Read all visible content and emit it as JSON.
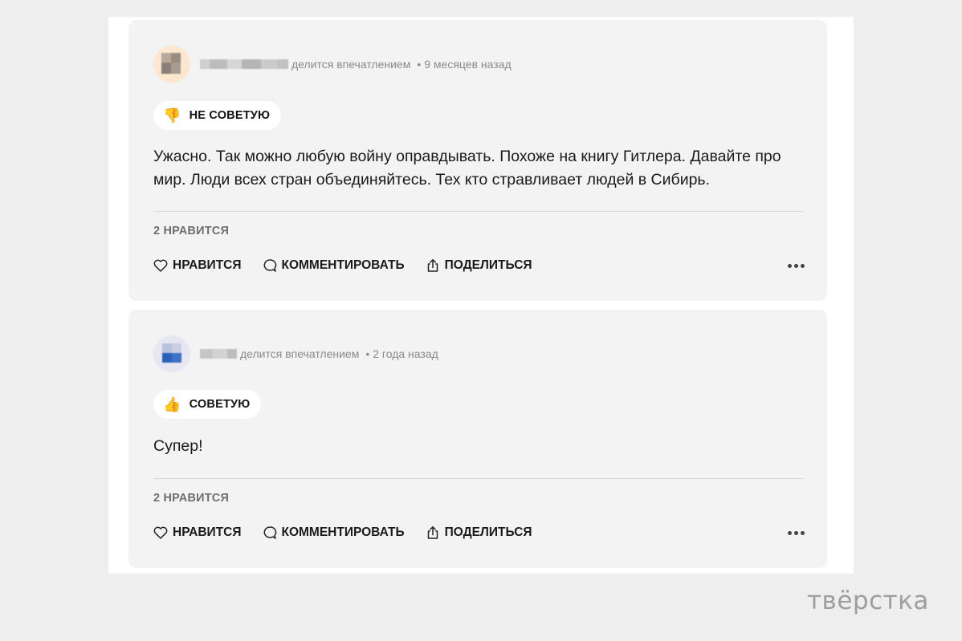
{
  "reviews": [
    {
      "meta": "делится впечатлением",
      "time": "9 месяцев назад",
      "verdict_emoji": "👎",
      "verdict": "НЕ СОВЕТУЮ",
      "text": "Ужасно. Так можно любую войну оправдывать. Похоже на книгу Гитлера. Давайте про мир. Люди всех стран объединяйтесь. Тех кто стравливает людей в Сибирь.",
      "likes": "2 НРАВИТСЯ"
    },
    {
      "meta": "делится впечатлением",
      "time": "2 года назад",
      "verdict_emoji": "👍",
      "verdict": "СОВЕТУЮ",
      "text": "Супер!",
      "likes": "2 НРАВИТСЯ"
    }
  ],
  "actions": {
    "like": "НРАВИТСЯ",
    "comment": "КОММЕНТИРОВАТЬ",
    "share": "ПОДЕЛИТЬСЯ"
  },
  "icons": {
    "like": "heart-icon",
    "comment": "speech-bubble-icon",
    "share": "share-icon",
    "more": "more-dots-icon"
  },
  "watermark": "твёрстка"
}
